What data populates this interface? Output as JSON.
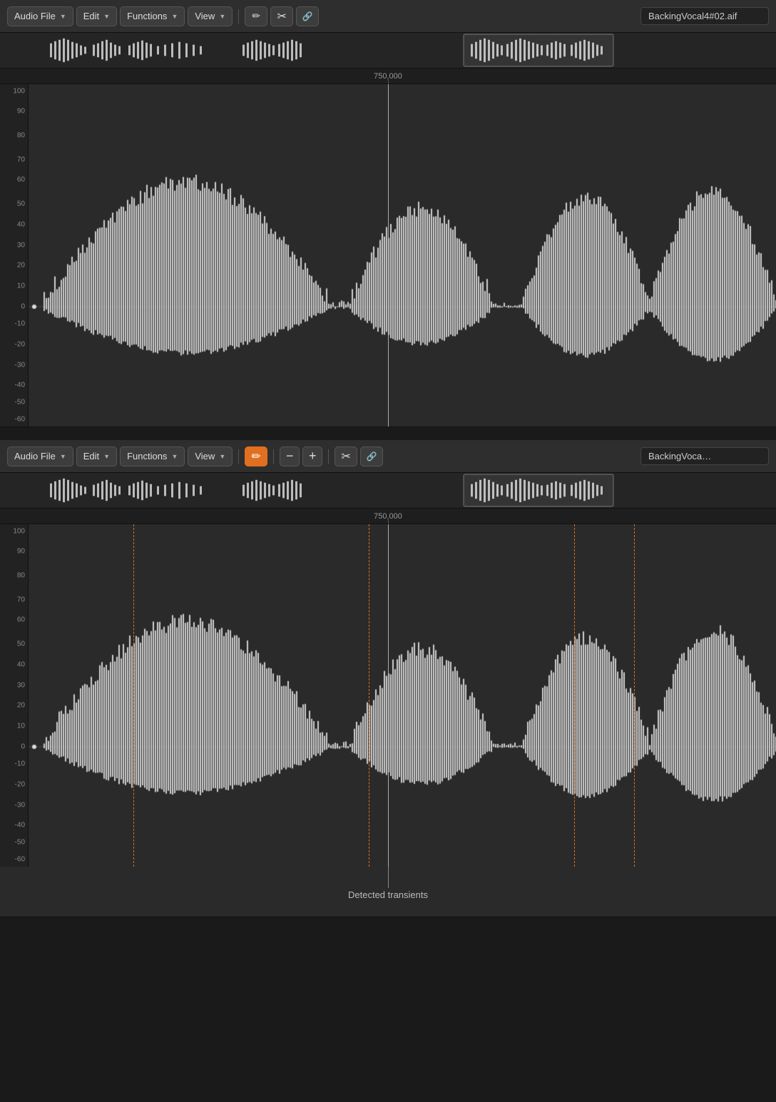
{
  "panel1": {
    "toolbar": {
      "audio_file_label": "Audio File",
      "edit_label": "Edit",
      "functions_label": "Functions",
      "view_label": "View",
      "pencil_icon": "✏",
      "scissors_icon": "✂",
      "link_icon": "🔗",
      "filename": "BackingVocal4#02.aif",
      "transient_btn_active": false
    },
    "ruler": {
      "label": "750,000"
    },
    "waveform": {
      "has_transients": false
    }
  },
  "panel2": {
    "toolbar": {
      "audio_file_label": "Audio File",
      "edit_label": "Edit",
      "functions_label": "Functions",
      "view_label": "View",
      "pencil_icon": "✏",
      "scissors_icon": "✂",
      "link_icon": "🔗",
      "filename": "BackingVoca…",
      "transient_btn_active": true,
      "minus_label": "−",
      "plus_label": "+"
    },
    "ruler": {
      "label": "750,000"
    },
    "waveform": {
      "has_transients": true,
      "transient_positions": [
        0.14,
        0.455,
        0.73,
        0.81
      ]
    },
    "annotation": {
      "label": "Detected transients"
    }
  },
  "yaxis_labels": [
    "100",
    "90",
    "80",
    "70",
    "60",
    "50",
    "40",
    "30",
    "20",
    "10",
    "0",
    "-10",
    "-20",
    "-30",
    "-40",
    "-50",
    "-60"
  ]
}
